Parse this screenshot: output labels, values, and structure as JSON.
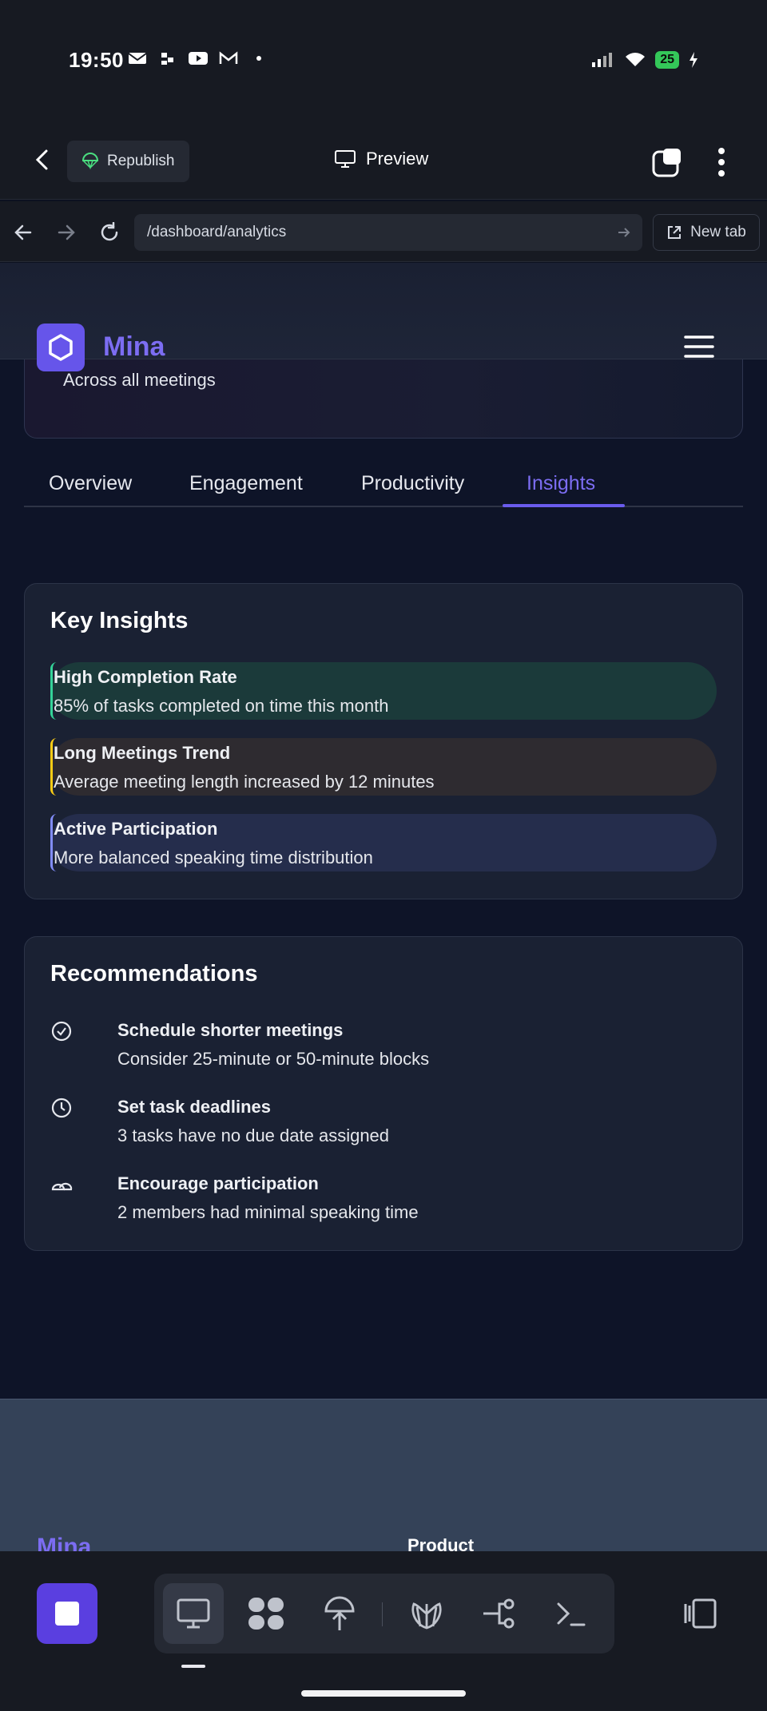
{
  "status_bar": {
    "time": "19:50",
    "battery": "25"
  },
  "topbar": {
    "republish_label": "Republish",
    "preview_label": "Preview"
  },
  "urlbar": {
    "url": "/dashboard/analytics",
    "new_tab_label": "New tab"
  },
  "site": {
    "brand": "Mina"
  },
  "previous_card": {
    "subtitle": "Across all meetings"
  },
  "tabs": [
    {
      "label": "Overview"
    },
    {
      "label": "Engagement"
    },
    {
      "label": "Productivity"
    },
    {
      "label": "Insights",
      "active": true
    }
  ],
  "key_insights": {
    "title": "Key Insights",
    "items": [
      {
        "title": "High Completion Rate",
        "desc": "85% of tasks completed on time this month",
        "accent": "#34d399",
        "bg": "#1b3a3a"
      },
      {
        "title": "Long Meetings Trend",
        "desc": "Average meeting length increased by 12 minutes",
        "accent": "#facc15",
        "bg": "#2e2b30"
      },
      {
        "title": "Active Participation",
        "desc": "More balanced speaking time distribution",
        "accent": "#818cf8",
        "bg": "#252d4c"
      }
    ]
  },
  "recommendations": {
    "title": "Recommendations",
    "items": [
      {
        "icon": "check-circle-icon",
        "title": "Schedule shorter meetings",
        "desc": "Consider 25-minute or 50-minute blocks"
      },
      {
        "icon": "clock-icon",
        "title": "Set task deadlines",
        "desc": "3 tasks have no due date assigned"
      },
      {
        "icon": "users-icon",
        "title": "Encourage participation",
        "desc": "2 members had minimal speaking time"
      }
    ]
  },
  "footer": {
    "brand": "Mina",
    "column_title": "Product"
  },
  "colors": {
    "accent": "#6a5ced",
    "background": "#0e1428",
    "card": "#1a2133"
  }
}
